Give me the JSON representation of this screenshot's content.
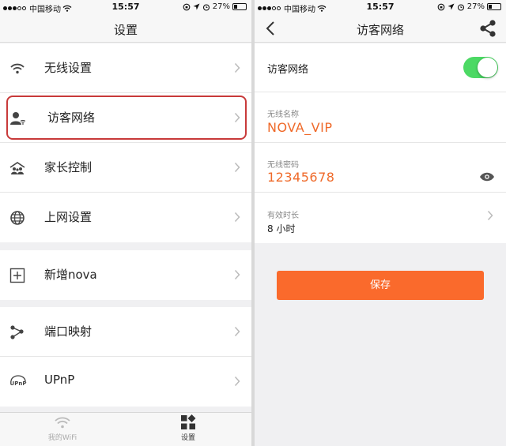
{
  "status_bar": {
    "carrier": "中国移动",
    "time": "15:57",
    "battery": "27%"
  },
  "left_screen": {
    "title": "设置",
    "groups": [
      {
        "items": [
          {
            "label": "无线设置",
            "icon": "wifi-icon"
          },
          {
            "label": "访客网络",
            "icon": "guest-user-icon",
            "highlighted": true
          },
          {
            "label": "家长控制",
            "icon": "parental-control-icon"
          },
          {
            "label": "上网设置",
            "icon": "globe-icon"
          }
        ]
      },
      {
        "items": [
          {
            "label": "新增nova",
            "icon": "add-device-icon"
          }
        ]
      },
      {
        "items": [
          {
            "label": "端口映射",
            "icon": "port-mapping-icon"
          },
          {
            "label": "UPnP",
            "icon": "upnp-icon"
          }
        ]
      }
    ],
    "tab_bar": [
      {
        "label": "我的WiFi",
        "icon": "wifi-icon",
        "active": false
      },
      {
        "label": "设置",
        "icon": "settings-grid-icon",
        "active": true
      }
    ]
  },
  "right_screen": {
    "title": "访客网络",
    "guest_network": {
      "label": "访客网络",
      "enabled": true
    },
    "wireless_name": {
      "label": "无线名称",
      "value": "NOVA_VIP"
    },
    "wireless_password": {
      "label": "无线密码",
      "value": "12345678"
    },
    "duration": {
      "label": "有效时长",
      "value": "8 小时"
    },
    "save_label": "保存"
  },
  "colors": {
    "accent": "#fa6a2c",
    "value_text": "#ef6a2a",
    "toggle_on": "#4cd964",
    "highlight_border": "#c83a3a"
  }
}
